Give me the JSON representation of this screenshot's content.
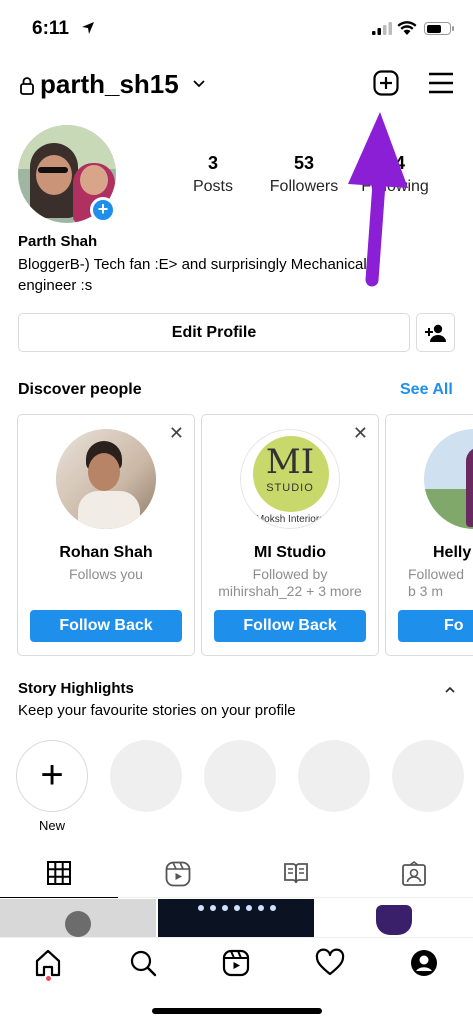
{
  "status_bar": {
    "time": "6:11"
  },
  "header": {
    "username": "parth_sh15"
  },
  "profile": {
    "stats": [
      {
        "count": "3",
        "label": "Posts"
      },
      {
        "count": "53",
        "label": "Followers"
      },
      {
        "count": "44",
        "label": "Following"
      }
    ],
    "name": "Parth Shah",
    "bio": "BloggerB-) Tech fan :E> and surprisingly Mechanical engineer :s",
    "edit_profile_label": "Edit Profile"
  },
  "discover": {
    "title": "Discover people",
    "see_all": "See All",
    "cards": [
      {
        "name": "Rohan Shah",
        "subtitle": "Follows you",
        "button": "Follow Back"
      },
      {
        "name": "MI Studio",
        "subtitle": "Followed by mihirshah_22 + 3 more",
        "button": "Follow Back",
        "logo_top": "MI",
        "logo_bottom": "STUDIO",
        "logo_caption": "Moksh Interiors"
      },
      {
        "name": "Helly",
        "subtitle": "Followed b 3 m",
        "button": "Fo"
      }
    ]
  },
  "highlights": {
    "title": "Story Highlights",
    "subtitle": "Keep your favourite stories on your profile",
    "new_label": "New"
  },
  "colors": {
    "accent": "#1f8fec",
    "annotation_arrow": "#8a1fd6",
    "notification_dot": "#ed4956"
  },
  "icons": [
    "lock-icon",
    "chevron-down-icon",
    "new-post-icon",
    "menu-icon",
    "add-person-icon",
    "close-icon",
    "grid-icon",
    "reels-icon",
    "guides-icon",
    "tagged-icon",
    "home-icon",
    "search-icon",
    "reels-nav-icon",
    "heart-icon",
    "profile-icon"
  ]
}
